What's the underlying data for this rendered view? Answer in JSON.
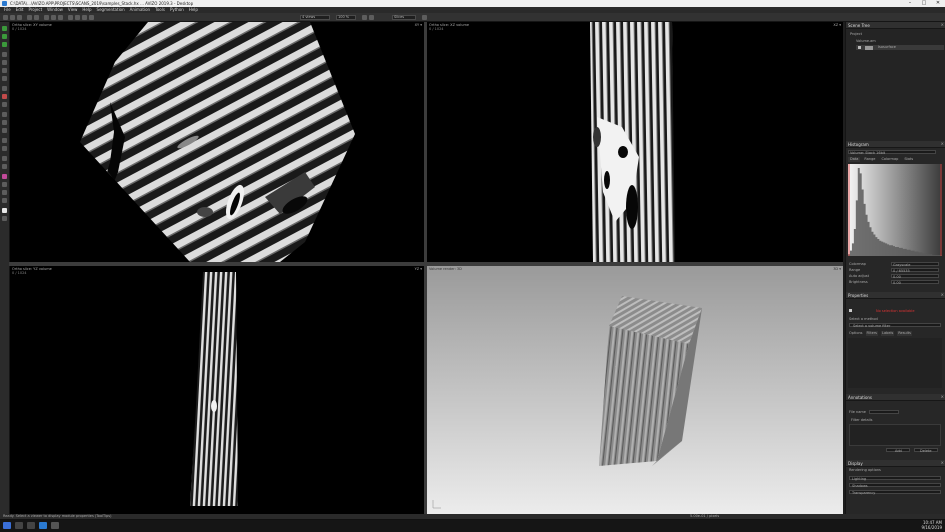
{
  "window": {
    "title": "C:\\DATA\\...\\AVIZO.APP\\PROJECTS\\SCANS_2019\\samples_Stack.hx ... AVIZO 2019.3 - Desktop",
    "controls": [
      "–",
      "□",
      "✕"
    ]
  },
  "menu": [
    "File",
    "Edit",
    "Project",
    "Window",
    "View",
    "Help",
    "Segmentation",
    "Animation",
    "Tools",
    "Python",
    "Help"
  ],
  "toolbar": {
    "dropdown_layout": "4 views",
    "dropdown_zoom": "100 %",
    "dropdown_mode": "Slices"
  },
  "viewports": {
    "top_left": {
      "title": "Ortho slice: XY volume",
      "subtitle": "0 / 1024",
      "controls": "XY ▾"
    },
    "top_right": {
      "title": "Ortho slice: XZ volume",
      "subtitle": "0 / 1024",
      "controls": "XZ ▾"
    },
    "bottom_left": {
      "title": "Ortho slice: YZ volume",
      "subtitle": "0 / 1024",
      "controls": "YZ ▾"
    },
    "bottom_right": {
      "title": "Volume render: 3D",
      "subtitle": "",
      "controls": "3D ▾"
    }
  },
  "right_panel": {
    "project_tree": {
      "header": "Scene Tree",
      "items": [
        "Project",
        "Volume.am",
        "Isosurface"
      ]
    },
    "histogram": {
      "header": "Histogram",
      "dropdown": "Volume: Stack 16bit",
      "tabs": [
        "Data",
        "Range",
        "Colormap",
        "Stats"
      ],
      "fields": [
        {
          "label": "Colormap",
          "value": "Grayscale"
        },
        {
          "label": "Range",
          "value": "0 / 65535"
        },
        {
          "label": "Auto adjust",
          "value": "0.00"
        },
        {
          "label": "Brightness",
          "value": "0.00"
        }
      ],
      "bins": [
        2,
        6,
        14,
        30,
        62,
        98,
        92,
        74,
        58,
        46,
        38,
        32,
        27,
        24,
        21,
        19,
        17,
        16,
        15,
        14,
        13,
        12,
        12,
        11,
        10,
        10,
        9,
        9,
        8,
        8,
        7,
        7,
        6,
        6,
        5,
        5,
        4,
        4,
        3,
        3,
        2,
        2,
        2,
        1,
        1,
        1,
        1,
        1
      ]
    },
    "properties": {
      "header": "Properties",
      "warning": "No selection available",
      "label_method": "Select a method",
      "dropdown": "Select a volume filter",
      "tabs": [
        "Options",
        "Filters",
        "Labels",
        "Results"
      ]
    },
    "annotations": {
      "header": "Annotations",
      "item": "File name",
      "sub": "Filter details",
      "buttons": [
        "Add",
        "Delete"
      ]
    },
    "display": {
      "header": "Display",
      "warning": "Rendering options",
      "items": [
        "Lighting",
        "Shadows",
        "Transparency"
      ]
    }
  },
  "status": {
    "message": "Ready. Select a viewer to display module properties (ToolTips)",
    "center": "5.00e-01 / pixels"
  },
  "clock": {
    "time": "10:47 AM",
    "date": "9/16/2019"
  },
  "colors": {
    "accent": "#2b7ad1",
    "panel": "#272727",
    "warning_red": "#d33",
    "histogram_fill": "#5a5a5a"
  }
}
